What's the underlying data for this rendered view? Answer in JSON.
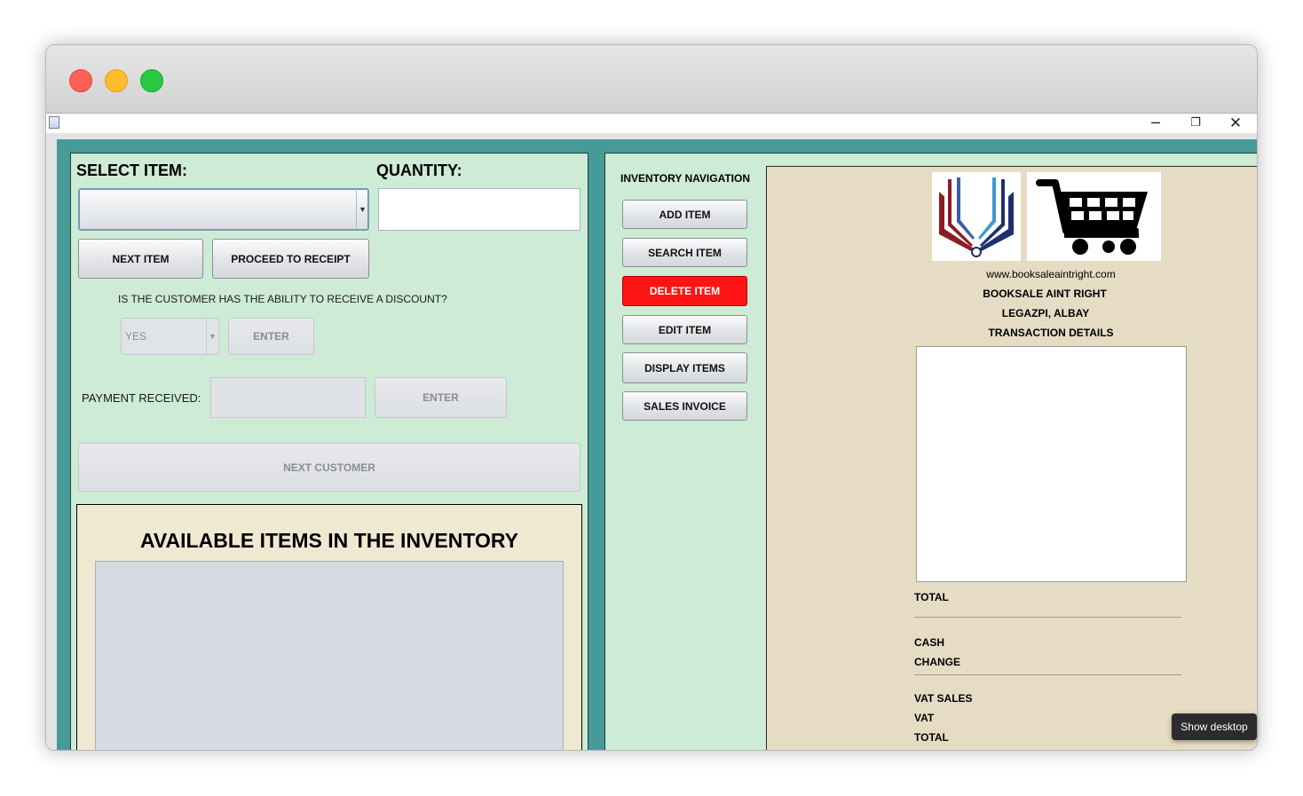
{
  "window": {
    "controls": {
      "minimize": "─",
      "maximize": "❐",
      "close": "✕"
    }
  },
  "sale": {
    "select_item_label": "SELECT ITEM:",
    "quantity_label": "QUANTITY:",
    "select_item_value": "",
    "quantity_value": "",
    "next_item": "NEXT ITEM",
    "proceed_to_receipt": "PROCEED TO RECEIPT",
    "discount_question": "IS THE CUSTOMER HAS THE ABILITY TO RECEIVE A DISCOUNT?",
    "discount_value": "YES",
    "discount_enter": "ENTER",
    "payment_label": "PAYMENT RECEIVED:",
    "payment_value": "",
    "payment_enter": "ENTER",
    "next_customer": "NEXT CUSTOMER"
  },
  "inventory": {
    "title": "AVAILABLE ITEMS IN THE INVENTORY"
  },
  "navigation": {
    "title": "INVENTORY NAVIGATION",
    "add_item": "ADD ITEM",
    "search_item": "SEARCH ITEM",
    "delete_item": "DELETE ITEM",
    "edit_item": "EDIT ITEM",
    "display_items": "DISPLAY ITEMS",
    "sales_invoice": "SALES INVOICE"
  },
  "receipt": {
    "website": "www.booksaleaintright.com",
    "store_name": "BOOKSALE AINT RIGHT",
    "location": "LEGAZPI, ALBAY",
    "heading": "TRANSACTION DETAILS",
    "total": "TOTAL",
    "cash": "CASH",
    "change": "CHANGE",
    "vat_sales": "VAT SALES",
    "vat": "VAT",
    "grand_total": "TOTAL"
  },
  "taskbar": {
    "tooltip": "Show desktop"
  },
  "colors": {
    "panel_green": "#cdebd5",
    "frame_teal": "#479a97",
    "receipt_beige": "#e6dcc4",
    "inventory_beige": "#f0e9d2",
    "delete_red": "#ff1414"
  },
  "icons": {
    "book_logo": "open-book-logo-icon",
    "cart_logo": "shopping-cart-icon"
  }
}
